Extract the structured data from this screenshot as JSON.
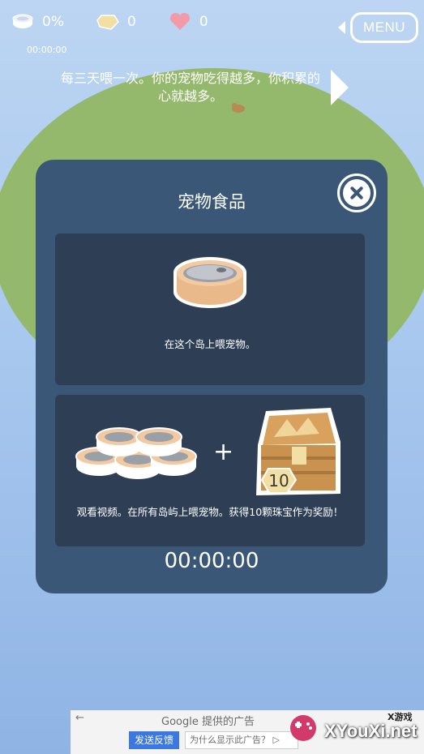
{
  "hud": {
    "food_percent": "0%",
    "gems": "0",
    "hearts": "0",
    "timer": "00:00:00",
    "menu_label": "MENU"
  },
  "tip": "每三天喂一次。你的宠物吃得越多，你积累的心就越多。",
  "modal": {
    "title": "宠物食品",
    "option1_text": "在这个岛上喂宠物。",
    "option2_text": "观看视频。在所有岛屿上喂宠物。获得10颗珠宝作为奖励！",
    "plus": "+",
    "gem_reward": "10",
    "timer": "00:00:00"
  },
  "ad": {
    "back": "←",
    "title": "Google 提供的广告",
    "feedback": "发送反馈",
    "why": "为什么显示此广告？ ▷"
  },
  "watermark": {
    "site": "XYouXi.net",
    "tag": "X游戏"
  },
  "colors": {
    "modal_bg": "#3a5778",
    "card_bg": "#2e3f55",
    "island": "#95b96c",
    "sky": "#a9c8ef",
    "food_tin": "#eab98a",
    "chest": "#c9924f"
  }
}
